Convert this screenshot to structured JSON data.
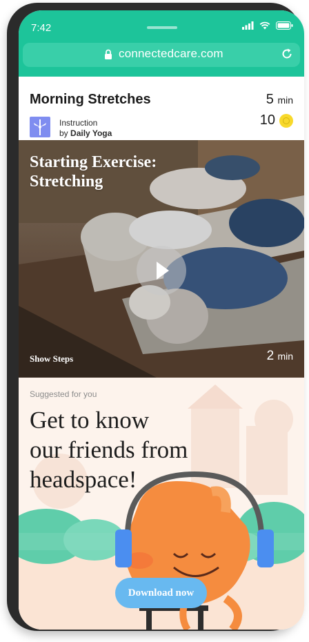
{
  "status": {
    "time": "7:42"
  },
  "browser": {
    "url": "connectedcare.com"
  },
  "header": {
    "title": "Morning Stretches",
    "duration_value": "5",
    "duration_unit": "min",
    "points": "10",
    "instruction_label": "Instruction",
    "by_prefix": "by",
    "author": "Daily Yoga"
  },
  "video": {
    "title_line1": "Starting Exercise:",
    "title_line2": "Stretching",
    "show_steps": "Show Steps",
    "duration_value": "2",
    "duration_unit": "min"
  },
  "suggestion": {
    "label": "Suggested for you",
    "headline_line1": "Get to know",
    "headline_line2": "our friends from",
    "headline_line3": "headspace!",
    "cta": "Download now"
  },
  "colors": {
    "brand_green": "#1dc49a",
    "cta_blue": "#68b9f0",
    "coin_yellow": "#f8d92b",
    "mascot_orange": "#f58c3f",
    "suggest_bg": "#fdf3ec"
  },
  "icons": [
    "signal-icon",
    "wifi-icon",
    "battery-icon",
    "lock-icon",
    "reload-icon",
    "coin-icon",
    "daily-yoga-logo-icon",
    "play-icon"
  ]
}
